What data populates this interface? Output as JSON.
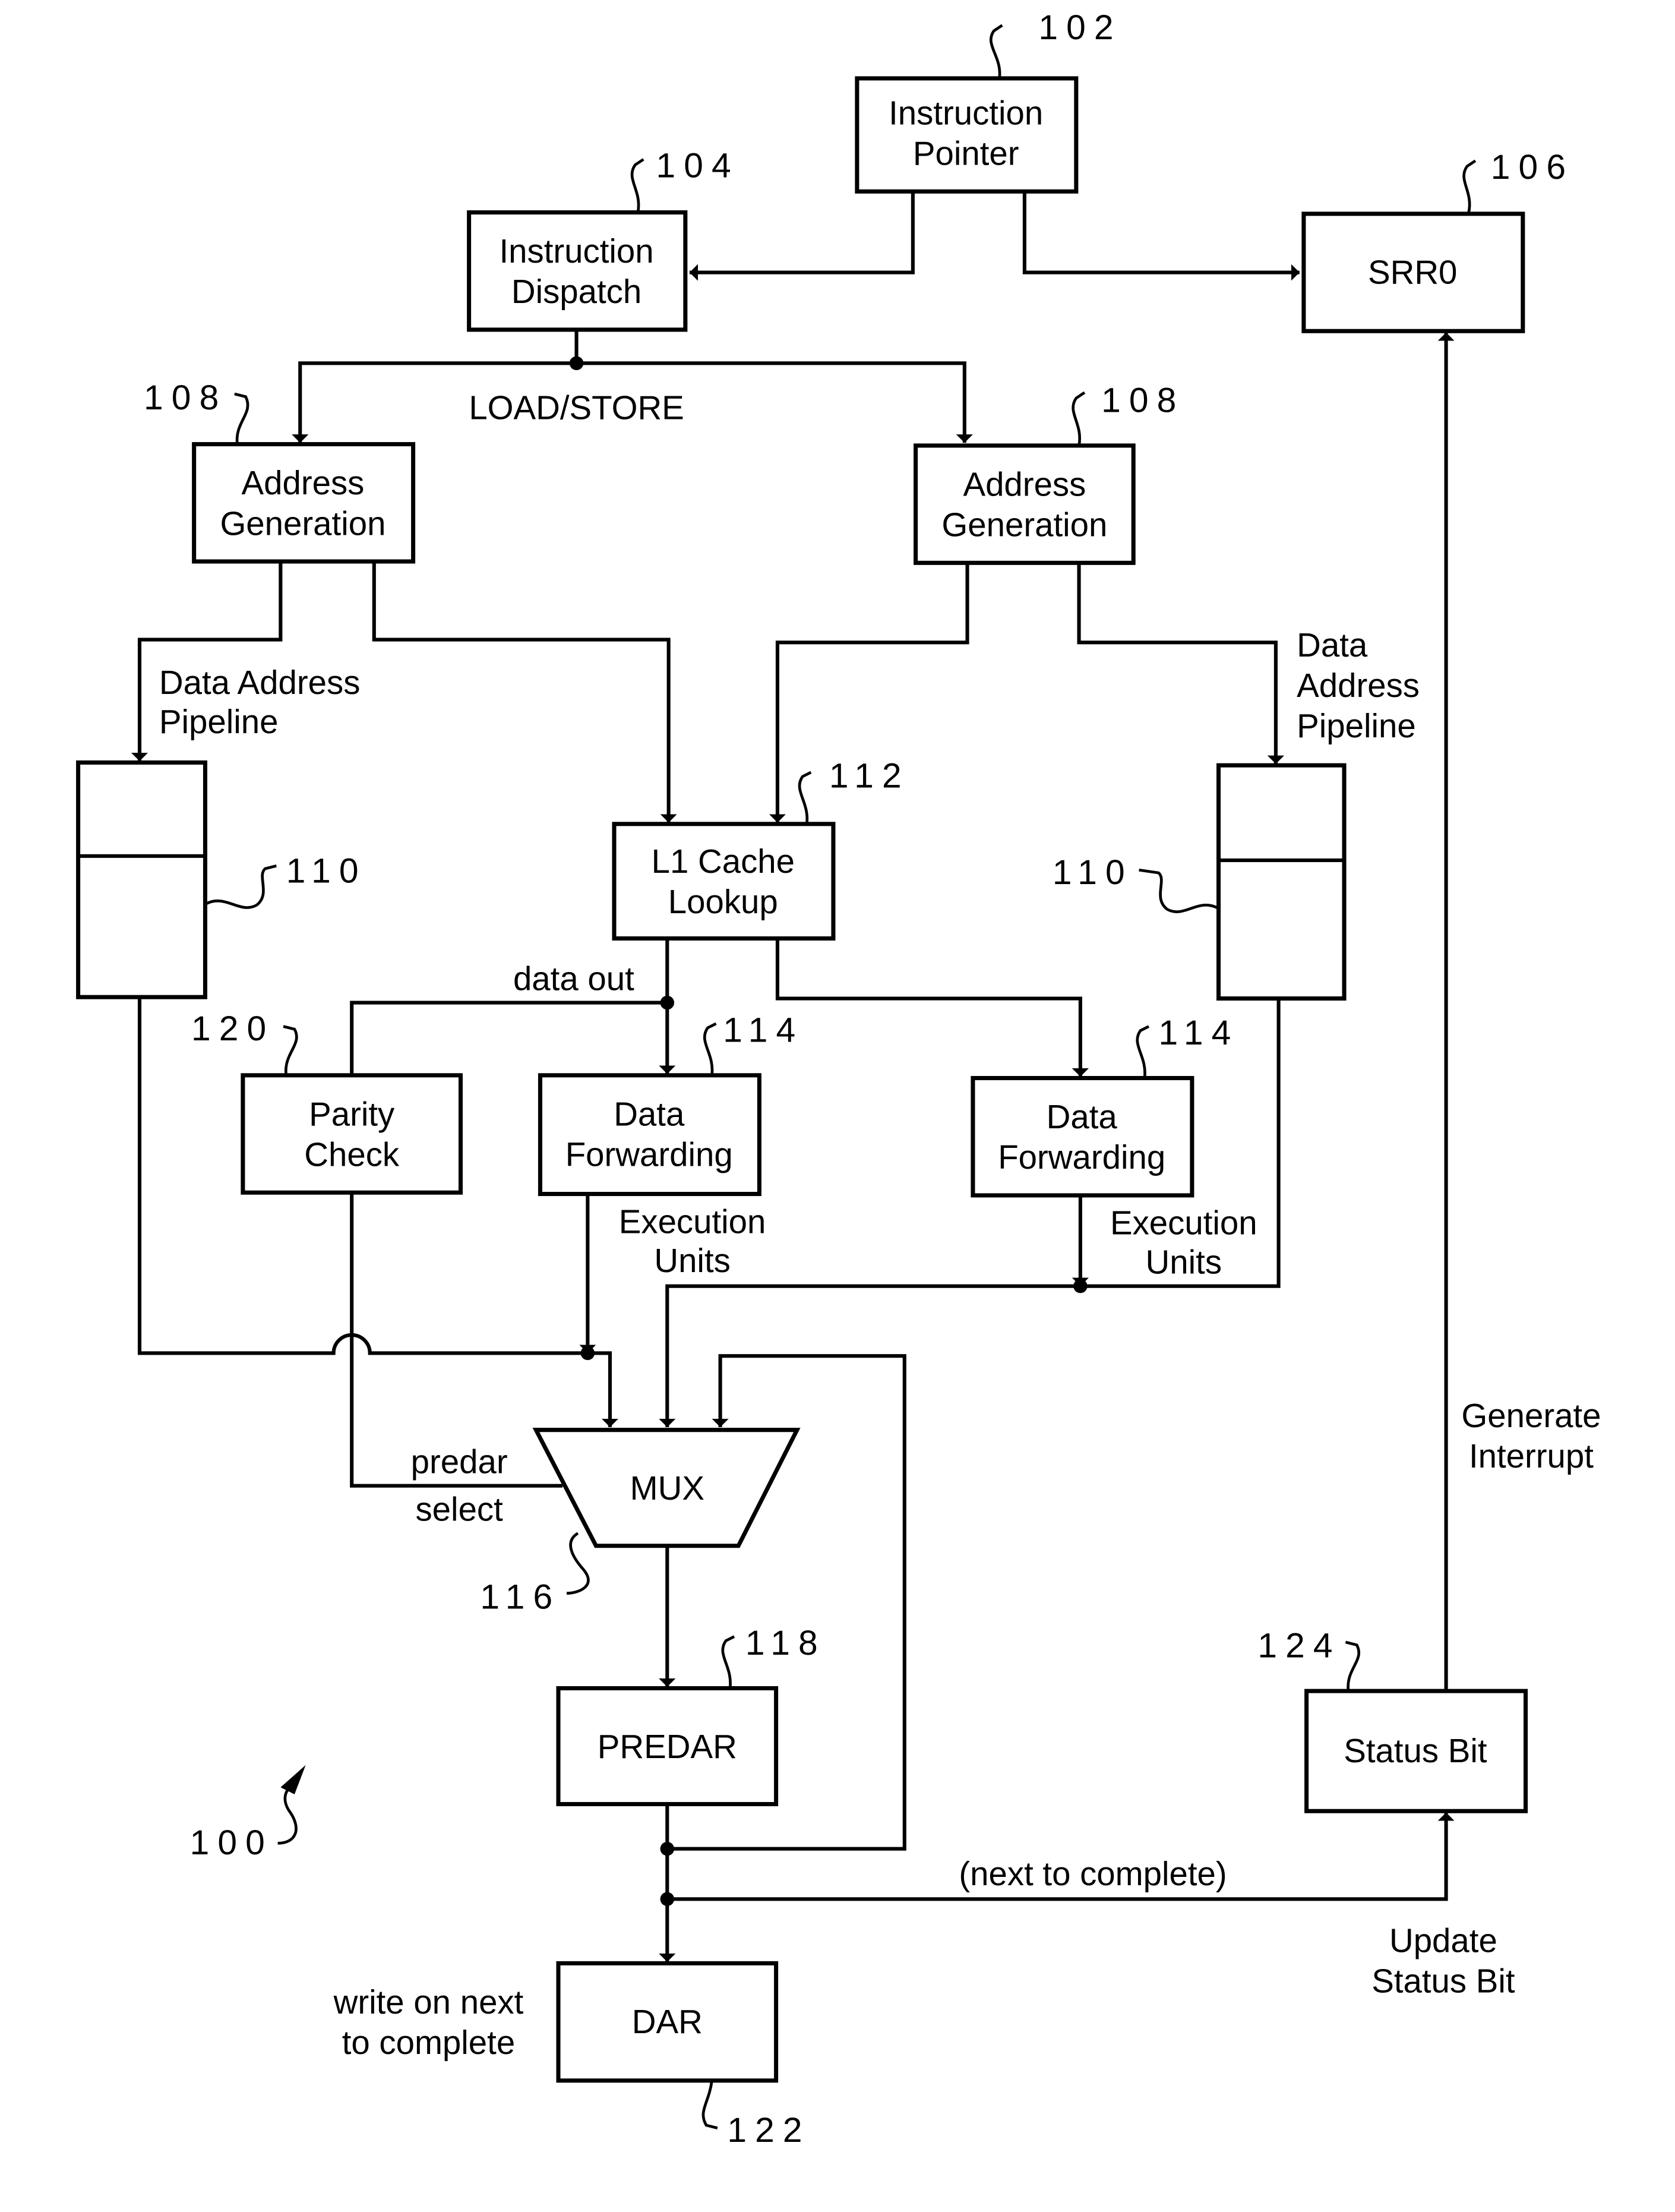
{
  "figure": {
    "ref": "100",
    "blocks": {
      "instruction_pointer": {
        "ref": "102",
        "lines": [
          "Instruction",
          "Pointer"
        ]
      },
      "instruction_dispatch": {
        "ref": "104",
        "lines": [
          "Instruction",
          "Dispatch"
        ]
      },
      "srr0": {
        "ref": "106",
        "lines": [
          "SRR0"
        ]
      },
      "address_generation_left": {
        "ref": "108",
        "lines": [
          "Address",
          "Generation"
        ]
      },
      "address_generation_right": {
        "ref": "108",
        "lines": [
          "Address",
          "Generation"
        ]
      },
      "pipeline_left": {
        "ref": "110"
      },
      "pipeline_right": {
        "ref": "110"
      },
      "l1_cache": {
        "ref": "112",
        "lines": [
          "L1 Cache",
          "Lookup"
        ]
      },
      "data_forwarding_left": {
        "ref": "114",
        "lines": [
          "Data",
          "Forwarding"
        ]
      },
      "data_forwarding_right": {
        "ref": "114",
        "lines": [
          "Data",
          "Forwarding"
        ]
      },
      "mux": {
        "ref": "116",
        "lines": [
          "MUX"
        ]
      },
      "predar": {
        "ref": "118",
        "lines": [
          "PREDAR"
        ]
      },
      "parity_check": {
        "ref": "120",
        "lines": [
          "Parity",
          "Check"
        ]
      },
      "dar": {
        "ref": "122",
        "lines": [
          "DAR"
        ]
      },
      "status_bit": {
        "ref": "124",
        "lines": [
          "Status Bit"
        ]
      }
    },
    "signals": {
      "load_store": "LOAD/STORE",
      "data_address_pipeline_left": [
        "Data Address",
        "Pipeline"
      ],
      "data_address_pipeline_right": [
        "Data",
        "Address",
        "Pipeline"
      ],
      "data_out": "data out",
      "execution_units_left": [
        "Execution",
        "Units"
      ],
      "execution_units_right": [
        "Execution",
        "Units"
      ],
      "predar_select": [
        "predar",
        "select"
      ],
      "next_to_complete": "(next to complete)",
      "write_on_next": [
        "write on next",
        "to complete"
      ],
      "update_status_bit": [
        "Update",
        "Status Bit"
      ],
      "generate_interrupt": [
        "Generate",
        "Interrupt"
      ]
    }
  }
}
